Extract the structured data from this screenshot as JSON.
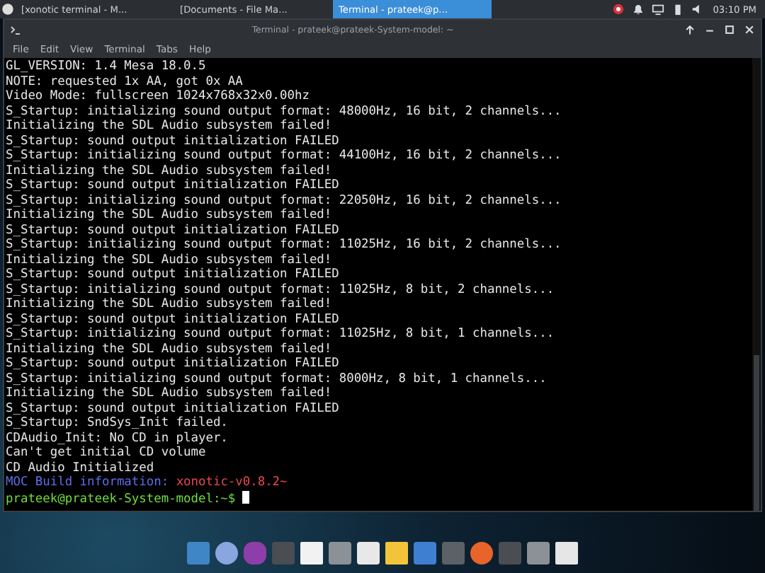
{
  "panel": {
    "tasks": [
      {
        "label": "[xonotic terminal - M...",
        "selected": false
      },
      {
        "label": "[Documents - File Ma...",
        "selected": false
      },
      {
        "label": "Terminal - prateek@p...",
        "selected": true
      }
    ],
    "clock": "03:10 PM"
  },
  "window": {
    "title": "Terminal - prateek@prateek-System-model: ~"
  },
  "menu": [
    "File",
    "Edit",
    "View",
    "Terminal",
    "Tabs",
    "Help"
  ],
  "terminal": {
    "lines": [
      {
        "kind": "output",
        "text": "GL_VERSION: 1.4 Mesa 18.0.5"
      },
      {
        "kind": "output",
        "text": "NOTE: requested 1x AA, got 0x AA"
      },
      {
        "kind": "output",
        "text": "Video Mode: fullscreen 1024x768x32x0.00hz"
      },
      {
        "kind": "output",
        "text": "S_Startup: initializing sound output format: 48000Hz, 16 bit, 2 channels..."
      },
      {
        "kind": "output",
        "text": "Initializing the SDL Audio subsystem failed!"
      },
      {
        "kind": "output",
        "text": "S_Startup: sound output initialization FAILED"
      },
      {
        "kind": "output",
        "text": "S_Startup: initializing sound output format: 44100Hz, 16 bit, 2 channels..."
      },
      {
        "kind": "output",
        "text": "Initializing the SDL Audio subsystem failed!"
      },
      {
        "kind": "output",
        "text": "S_Startup: sound output initialization FAILED"
      },
      {
        "kind": "output",
        "text": "S_Startup: initializing sound output format: 22050Hz, 16 bit, 2 channels..."
      },
      {
        "kind": "output",
        "text": "Initializing the SDL Audio subsystem failed!"
      },
      {
        "kind": "output",
        "text": "S_Startup: sound output initialization FAILED"
      },
      {
        "kind": "output",
        "text": "S_Startup: initializing sound output format: 11025Hz, 16 bit, 2 channels..."
      },
      {
        "kind": "output",
        "text": "Initializing the SDL Audio subsystem failed!"
      },
      {
        "kind": "output",
        "text": "S_Startup: sound output initialization FAILED"
      },
      {
        "kind": "output",
        "text": "S_Startup: initializing sound output format: 11025Hz, 8 bit, 2 channels..."
      },
      {
        "kind": "output",
        "text": "Initializing the SDL Audio subsystem failed!"
      },
      {
        "kind": "output",
        "text": "S_Startup: sound output initialization FAILED"
      },
      {
        "kind": "output",
        "text": "S_Startup: initializing sound output format: 11025Hz, 8 bit, 1 channels..."
      },
      {
        "kind": "output",
        "text": "Initializing the SDL Audio subsystem failed!"
      },
      {
        "kind": "output",
        "text": "S_Startup: sound output initialization FAILED"
      },
      {
        "kind": "output",
        "text": "S_Startup: initializing sound output format: 8000Hz, 8 bit, 1 channels..."
      },
      {
        "kind": "output",
        "text": "Initializing the SDL Audio subsystem failed!"
      },
      {
        "kind": "output",
        "text": "S_Startup: sound output initialization FAILED"
      },
      {
        "kind": "output",
        "text": "S_Startup: SndSys_Init failed."
      },
      {
        "kind": "output",
        "text": "CDAudio_Init: No CD in player."
      },
      {
        "kind": "output",
        "text": "Can't get initial CD volume"
      },
      {
        "kind": "output",
        "text": "CD Audio Initialized"
      },
      {
        "kind": "build",
        "label": "MOC Build information:",
        "value": "xonotic-v0.8.2~"
      },
      {
        "kind": "prompt",
        "text": "prateek@prateek-System-model:~$"
      }
    ]
  }
}
